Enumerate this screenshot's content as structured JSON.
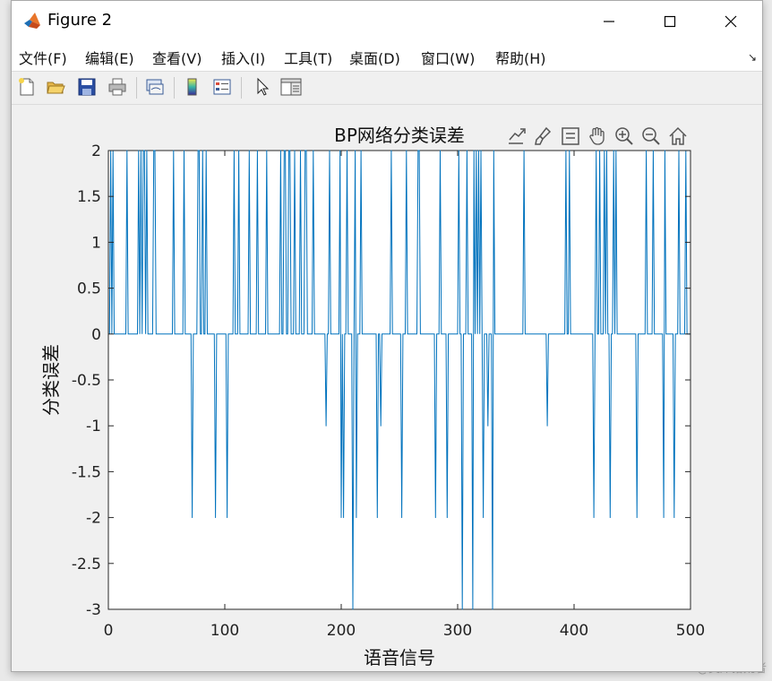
{
  "window": {
    "title": "Figure 2"
  },
  "menubar": {
    "items": [
      {
        "label": "文件(F)"
      },
      {
        "label": "编辑(E)"
      },
      {
        "label": "查看(V)"
      },
      {
        "label": "插入(I)"
      },
      {
        "label": "工具(T)"
      },
      {
        "label": "桌面(D)"
      },
      {
        "label": "窗口(W)"
      },
      {
        "label": "帮助(H)"
      }
    ]
  },
  "toolbar": {
    "icons": [
      "new-figure-icon",
      "open-file-icon",
      "save-icon",
      "print-icon",
      "link-plot-icon",
      "colorbar-icon",
      "legend-icon",
      "edit-plot-arrow-icon",
      "property-inspector-icon"
    ]
  },
  "axes_toolbar": {
    "icons": [
      "export-icon",
      "brush-icon",
      "data-tips-icon",
      "pan-hand-icon",
      "zoom-in-icon",
      "zoom-out-icon",
      "home-icon"
    ]
  },
  "watermark": "CSDN @灵犀拾荒者",
  "chart_data": {
    "type": "line",
    "title": "BP网络分类误差",
    "xlabel": "语音信号",
    "ylabel": "分类误差",
    "xlim": [
      0,
      500
    ],
    "ylim": [
      -3,
      2
    ],
    "xticks": [
      "0",
      "100",
      "200",
      "300",
      "400",
      "500"
    ],
    "yticks": [
      "2",
      "1.5",
      "1",
      "0.5",
      "0",
      "-0.5",
      "-1",
      "-1.5",
      "-2",
      "-2.5",
      "-3"
    ],
    "grid": false,
    "color": "#0072bd",
    "nonzero_points": [
      {
        "x": 2,
        "y": 2
      },
      {
        "x": 4,
        "y": 2
      },
      {
        "x": 16,
        "y": 2
      },
      {
        "x": 26,
        "y": 2
      },
      {
        "x": 28,
        "y": 2
      },
      {
        "x": 30,
        "y": 2
      },
      {
        "x": 31,
        "y": 2
      },
      {
        "x": 33,
        "y": 2
      },
      {
        "x": 39,
        "y": 2
      },
      {
        "x": 40,
        "y": 2
      },
      {
        "x": 56,
        "y": 2
      },
      {
        "x": 65,
        "y": 2
      },
      {
        "x": 72,
        "y": -2
      },
      {
        "x": 77,
        "y": 2
      },
      {
        "x": 78,
        "y": 2
      },
      {
        "x": 81,
        "y": 2
      },
      {
        "x": 84,
        "y": 2
      },
      {
        "x": 92,
        "y": -2
      },
      {
        "x": 102,
        "y": -2
      },
      {
        "x": 108,
        "y": 2
      },
      {
        "x": 112,
        "y": 2
      },
      {
        "x": 121,
        "y": 2
      },
      {
        "x": 128,
        "y": 2
      },
      {
        "x": 136,
        "y": 2
      },
      {
        "x": 148,
        "y": 2
      },
      {
        "x": 151,
        "y": 2
      },
      {
        "x": 152,
        "y": 2
      },
      {
        "x": 155,
        "y": 2
      },
      {
        "x": 156,
        "y": 2
      },
      {
        "x": 160,
        "y": 2
      },
      {
        "x": 165,
        "y": 2
      },
      {
        "x": 169,
        "y": 2
      },
      {
        "x": 170,
        "y": 2
      },
      {
        "x": 176,
        "y": 2
      },
      {
        "x": 187,
        "y": -1
      },
      {
        "x": 190,
        "y": 2
      },
      {
        "x": 199,
        "y": 2
      },
      {
        "x": 200,
        "y": -2
      },
      {
        "x": 202,
        "y": -2
      },
      {
        "x": 205,
        "y": 2
      },
      {
        "x": 210,
        "y": -3
      },
      {
        "x": 212,
        "y": 2
      },
      {
        "x": 213,
        "y": -2
      },
      {
        "x": 217,
        "y": 2
      },
      {
        "x": 231,
        "y": -2
      },
      {
        "x": 234,
        "y": -1
      },
      {
        "x": 243,
        "y": 2
      },
      {
        "x": 252,
        "y": -2
      },
      {
        "x": 256,
        "y": 2
      },
      {
        "x": 266,
        "y": 2
      },
      {
        "x": 267,
        "y": 2
      },
      {
        "x": 281,
        "y": -2
      },
      {
        "x": 285,
        "y": 2
      },
      {
        "x": 291,
        "y": -2
      },
      {
        "x": 301,
        "y": 2
      },
      {
        "x": 304,
        "y": -3
      },
      {
        "x": 308,
        "y": 2
      },
      {
        "x": 313,
        "y": -3
      },
      {
        "x": 314,
        "y": 2
      },
      {
        "x": 316,
        "y": 2
      },
      {
        "x": 318,
        "y": 2
      },
      {
        "x": 320,
        "y": 2
      },
      {
        "x": 322,
        "y": -2
      },
      {
        "x": 326,
        "y": -1
      },
      {
        "x": 330,
        "y": -3
      },
      {
        "x": 331,
        "y": 2
      },
      {
        "x": 357,
        "y": 2
      },
      {
        "x": 377,
        "y": -1
      },
      {
        "x": 393,
        "y": 2
      },
      {
        "x": 396,
        "y": 2
      },
      {
        "x": 417,
        "y": -2
      },
      {
        "x": 419,
        "y": 2
      },
      {
        "x": 422,
        "y": 2
      },
      {
        "x": 426,
        "y": 2
      },
      {
        "x": 428,
        "y": 2
      },
      {
        "x": 431,
        "y": -2
      },
      {
        "x": 434,
        "y": 2
      },
      {
        "x": 436,
        "y": 2
      },
      {
        "x": 454,
        "y": -2
      },
      {
        "x": 462,
        "y": 2
      },
      {
        "x": 468,
        "y": 2
      },
      {
        "x": 477,
        "y": -2
      },
      {
        "x": 478,
        "y": 2
      },
      {
        "x": 486,
        "y": -2
      },
      {
        "x": 490,
        "y": 2
      },
      {
        "x": 496,
        "y": 2
      }
    ]
  }
}
